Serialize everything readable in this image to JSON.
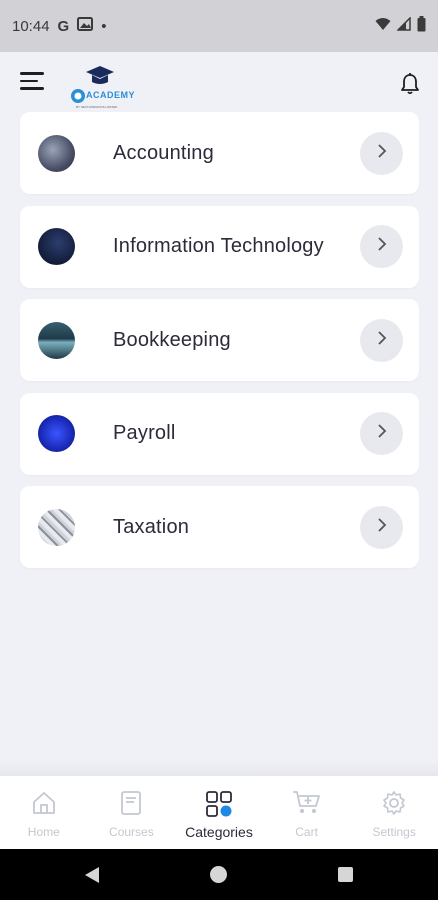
{
  "status_bar": {
    "time": "10:44",
    "g_letter": "G",
    "dot": "•"
  },
  "header": {
    "logo_text": "ACADEMY",
    "logo_subtext": "BY NEXTHORIZONS LIMITED"
  },
  "categories": [
    {
      "label": "Accounting"
    },
    {
      "label": "Information Technology"
    },
    {
      "label": "Bookkeeping"
    },
    {
      "label": "Payroll"
    },
    {
      "label": "Taxation"
    }
  ],
  "bottom_nav": [
    {
      "label": "Home",
      "icon": "home-icon",
      "active": false
    },
    {
      "label": "Courses",
      "icon": "book-icon",
      "active": false
    },
    {
      "label": "Categories",
      "icon": "categories-icon",
      "active": true
    },
    {
      "label": "Cart",
      "icon": "cart-icon",
      "active": false
    },
    {
      "label": "Settings",
      "icon": "gear-icon",
      "active": false
    }
  ],
  "colors": {
    "accent": "#1e88e5",
    "inactive": "#c3c8d0",
    "text": "#2b2b3a",
    "background": "#f0f1f6"
  }
}
